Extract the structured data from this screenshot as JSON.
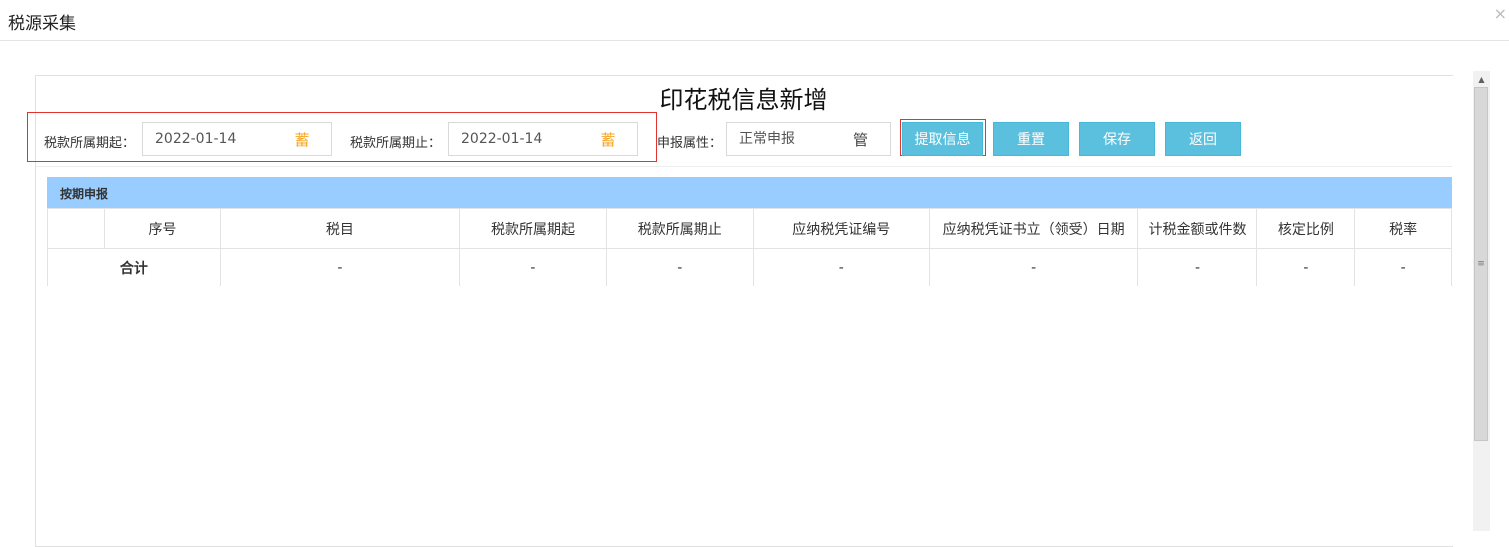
{
  "window": {
    "title": "税源采集",
    "close_glyph": "×"
  },
  "form": {
    "title": "印花税信息新增",
    "period_start": {
      "label": "税款所属期起：",
      "value": "2022-01-14",
      "icon": "calendar-icon",
      "glyph": "蓄"
    },
    "period_end": {
      "label": "税款所属期止：",
      "value": "2022-01-14",
      "icon": "calendar-icon",
      "glyph": "蓄"
    },
    "declare_attr": {
      "label": "申报属性：",
      "value": "正常申报",
      "icon": "select-icon",
      "glyph": "管"
    },
    "buttons": {
      "fetch": "提取信息",
      "reset": "重置",
      "save": "保存",
      "back": "返回"
    },
    "accent_color": "#5bc0de",
    "highlight_color": "#e0342f"
  },
  "section": {
    "title": "按期申报",
    "bar_color": "#99ccff",
    "columns": [
      "",
      "序号",
      "税目",
      "税款所属期起",
      "税款所属期止",
      "应纳税凭证编号",
      "应纳税凭证书立（领受）日期",
      "计税金额或件数",
      "核定比例",
      "税率"
    ],
    "total_row": {
      "label": "合计",
      "cells": [
        "-",
        "-",
        "-",
        "-",
        "-",
        "-",
        "-",
        "-"
      ]
    }
  },
  "scrollbar": {
    "up_glyph": "▲",
    "thumb_glyph": "≡"
  }
}
